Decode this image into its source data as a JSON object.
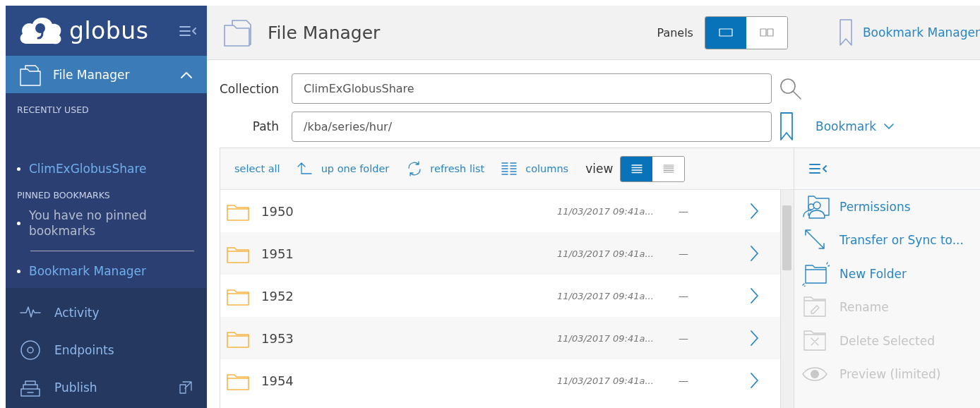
{
  "sidebar": {
    "brand": "globus",
    "nav": [
      {
        "label": "File Manager",
        "selected": true,
        "expanded": true
      }
    ],
    "recent_heading": "RECENTLY USED",
    "recent": [
      {
        "label": "ClimExGlobusShare"
      }
    ],
    "pinned_heading": "PINNED BOOKMARKS",
    "pinned_empty": "You have no pinned bookmarks",
    "manager_link": "Bookmark Manager",
    "lower_nav": [
      {
        "label": "Activity"
      },
      {
        "label": "Endpoints"
      },
      {
        "label": "Publish"
      }
    ]
  },
  "header": {
    "title": "File Manager",
    "panels_label": "Panels",
    "panels": [
      {
        "selected": true
      },
      {
        "selected": false
      }
    ],
    "bookmark_manager": "Bookmark Manager"
  },
  "collection": {
    "label": "Collection",
    "value": "ClimExGlobusShare"
  },
  "path": {
    "label": "Path",
    "value": "/kba/series/hur/",
    "bookmark": "Bookmark"
  },
  "toolbar": {
    "actions": [
      "select all",
      "up one folder",
      "refresh list",
      "columns"
    ],
    "view_label": "view",
    "views": [
      {
        "selected": true
      },
      {
        "selected": false
      }
    ]
  },
  "files": [
    {
      "name": "1950",
      "modified": "11/03/2017 09:41a...",
      "size": "—"
    },
    {
      "name": "1951",
      "modified": "11/03/2017 09:41a...",
      "size": "—"
    },
    {
      "name": "1952",
      "modified": "11/03/2017 09:41a...",
      "size": "—"
    },
    {
      "name": "1953",
      "modified": "11/03/2017 09:41a...",
      "size": "—"
    },
    {
      "name": "1954",
      "modified": "11/03/2017 09:41a...",
      "size": "—"
    }
  ],
  "actions": [
    {
      "label": "Permissions",
      "disabled": false
    },
    {
      "label": "Transfer or Sync to...",
      "disabled": false
    },
    {
      "label": "New Folder",
      "disabled": false
    },
    {
      "label": "Rename",
      "disabled": true
    },
    {
      "label": "Delete Selected",
      "disabled": true
    },
    {
      "label": "Preview (limited)",
      "disabled": true
    }
  ]
}
